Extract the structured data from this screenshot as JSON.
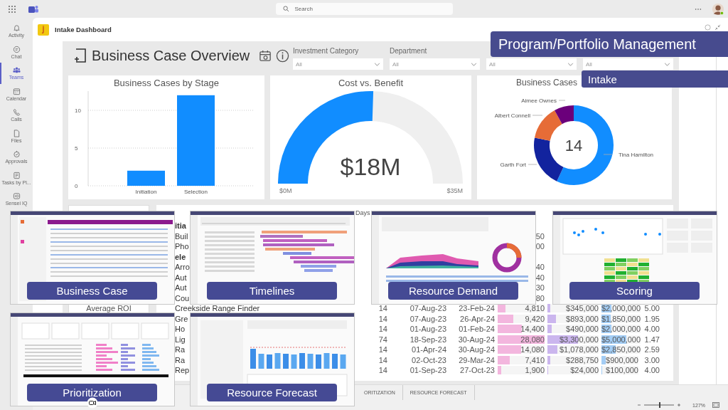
{
  "top_bar": {
    "search": {
      "placeholder": "Search"
    }
  },
  "app_rail": [
    {
      "label": "Activity",
      "selected": false
    },
    {
      "label": "Chat",
      "selected": false
    },
    {
      "label": "Teams",
      "selected": true
    },
    {
      "label": "Calendar",
      "selected": false
    },
    {
      "label": "Calls",
      "selected": false
    },
    {
      "label": "Files",
      "selected": false
    },
    {
      "label": "Approvals",
      "selected": false
    },
    {
      "label": "Tasks by Pl...",
      "selected": false
    },
    {
      "label": "Sensei IQ",
      "selected": false
    }
  ],
  "app_header": {
    "title": "Intake Dashboard"
  },
  "report": {
    "title": "Business Case Overview",
    "filters": [
      {
        "label": "Investment Category",
        "value": "All"
      },
      {
        "label": "Department",
        "value": "All"
      },
      {
        "value": "All"
      },
      {
        "value": "All"
      }
    ],
    "stage_chart": {
      "title": "Business Cases by Stage",
      "chart_data": {
        "type": "bar",
        "categories": [
          "Initiation",
          "Selection"
        ],
        "values": [
          2,
          12
        ],
        "ylim": [
          0,
          13
        ],
        "yticks": [
          0,
          5,
          10
        ]
      }
    },
    "cost_benefit": {
      "title": "Cost vs. Benefit",
      "value": "$18M",
      "min": "$0M",
      "max": "$35M",
      "level": 0.51
    },
    "owner_chart": {
      "title": "Business Cases",
      "total": "14",
      "chart_data": {
        "type": "donut",
        "categories": [
          "Tina Hamilton",
          "Garth Fort",
          "Albert Connell",
          "Aimee Ownes"
        ],
        "values": [
          57,
          21,
          14,
          8
        ],
        "colors": [
          "#118dff",
          "#12239e",
          "#e66c37",
          "#6b007b"
        ]
      }
    },
    "summary_cards": [
      {
        "label": "Average ROI"
      }
    ],
    "table": {
      "header": "Days",
      "rows": [
        {
          "name": "itia",
          "kind": "group"
        },
        {
          "name": "Buil",
          "kind": "item",
          "effort": {
            "text": "50"
          }
        },
        {
          "name": "Pho",
          "kind": "item",
          "effort": {
            "text": "00"
          }
        },
        {
          "name": "ele",
          "kind": "group"
        },
        {
          "name": "Arro",
          "kind": "item",
          "effort": {
            "text": "40"
          }
        },
        {
          "name": "Aut",
          "kind": "item",
          "effort": {
            "text": "40"
          }
        },
        {
          "name": "Aut",
          "kind": "item",
          "effort": {
            "text": "30"
          }
        },
        {
          "name": "Cou",
          "kind": "item",
          "effort": {
            "text": "80"
          }
        },
        {
          "name": "Creekside Range Finder",
          "kind": "item",
          "count": "14",
          "start": "07-Aug-23",
          "end": "23-Feb-24",
          "effort": {
            "text": "4,810",
            "level": 0.17
          },
          "cost": {
            "text": "$345,000",
            "level": 0.06
          },
          "benefit": {
            "text": "$2,000,000",
            "level": 0.25
          },
          "score": "5.00"
        },
        {
          "name": "Gre",
          "kind": "item",
          "count": "14",
          "start": "07-Aug-23",
          "end": "26-Apr-24",
          "effort": {
            "text": "9,420",
            "level": 0.34
          },
          "cost": {
            "text": "$893,000",
            "level": 0.16
          },
          "benefit": {
            "text": "$1,850,000",
            "level": 0.23
          },
          "score": "1.95"
        },
        {
          "name": "Ho",
          "kind": "item",
          "count": "14",
          "start": "01-Aug-23",
          "end": "01-Feb-24",
          "effort": {
            "text": "14,400",
            "level": 0.51
          },
          "cost": {
            "text": "$490,000",
            "level": 0.09
          },
          "benefit": {
            "text": "$2,000,000",
            "level": 0.25
          },
          "score": "4.00"
        },
        {
          "name": "Lig",
          "kind": "item",
          "count": "74",
          "start": "18-Sep-23",
          "end": "30-Aug-24",
          "effort": {
            "text": "28,080",
            "level": 1.0
          },
          "cost": {
            "text": "$3,300,000",
            "level": 0.6
          },
          "benefit": {
            "text": "$5,000,000",
            "level": 0.63
          },
          "score": "1.47"
        },
        {
          "name": "Ra",
          "kind": "item",
          "count": "14",
          "start": "01-Apr-24",
          "end": "30-Aug-24",
          "effort": {
            "text": "14,080",
            "level": 0.5
          },
          "cost": {
            "text": "$1,078,000",
            "level": 0.2
          },
          "benefit": {
            "text": "$2,850,000",
            "level": 0.36
          },
          "score": "2.59"
        },
        {
          "name": "Ra",
          "kind": "item",
          "count": "14",
          "start": "02-Oct-23",
          "end": "29-Mar-24",
          "effort": {
            "text": "7,410",
            "level": 0.26
          },
          "cost": {
            "text": "$288,750",
            "level": 0.05
          },
          "benefit": {
            "text": "$900,000",
            "level": 0.11
          },
          "score": "3.00"
        },
        {
          "name": "Rep",
          "kind": "item",
          "count": "14",
          "start": "01-Sep-23",
          "end": "27-Oct-23",
          "effort": {
            "text": "1,900",
            "level": 0.07
          },
          "cost": {
            "text": "$24,000",
            "level": 0.01
          },
          "benefit": {
            "text": "$100,000",
            "level": 0.02
          },
          "score": "4.00"
        }
      ]
    }
  },
  "tabs": [
    {
      "label": "ORITIZATION",
      "selected": false
    },
    {
      "label": "RESOURCE FORECAST",
      "selected": false
    }
  ],
  "zoom": {
    "value": "127%",
    "level": 0.52
  },
  "banners": [
    {
      "text": "Program/Portfolio Management",
      "kind": "title"
    },
    {
      "text": "Intake",
      "kind": "subtitle"
    }
  ],
  "thumbnails": [
    {
      "caption": "Business Case",
      "kind": "table"
    },
    {
      "caption": "Timelines",
      "kind": "gantt"
    },
    {
      "caption": "Resource Demand",
      "kind": "area"
    },
    {
      "caption": "Scoring",
      "kind": "scatter"
    },
    {
      "caption": "Prioritization",
      "kind": "priority"
    },
    {
      "caption": "Resource Forecast",
      "kind": "columns"
    }
  ]
}
